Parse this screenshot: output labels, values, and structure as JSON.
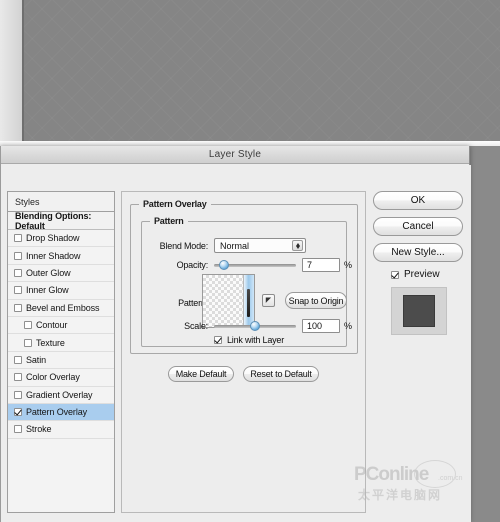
{
  "window": {
    "title": "Layer Style"
  },
  "styles_panel": {
    "header": "Styles",
    "blending_options": "Blending Options: Default",
    "items": [
      {
        "label": "Drop Shadow",
        "checked": false,
        "indent": false,
        "selected": false
      },
      {
        "label": "Inner Shadow",
        "checked": false,
        "indent": false,
        "selected": false
      },
      {
        "label": "Outer Glow",
        "checked": false,
        "indent": false,
        "selected": false
      },
      {
        "label": "Inner Glow",
        "checked": false,
        "indent": false,
        "selected": false
      },
      {
        "label": "Bevel and Emboss",
        "checked": false,
        "indent": false,
        "selected": false
      },
      {
        "label": "Contour",
        "checked": false,
        "indent": true,
        "selected": false
      },
      {
        "label": "Texture",
        "checked": false,
        "indent": true,
        "selected": false
      },
      {
        "label": "Satin",
        "checked": false,
        "indent": false,
        "selected": false
      },
      {
        "label": "Color Overlay",
        "checked": false,
        "indent": false,
        "selected": false
      },
      {
        "label": "Gradient Overlay",
        "checked": false,
        "indent": false,
        "selected": false
      },
      {
        "label": "Pattern Overlay",
        "checked": true,
        "indent": false,
        "selected": true
      },
      {
        "label": "Stroke",
        "checked": false,
        "indent": false,
        "selected": false
      }
    ]
  },
  "pattern_overlay": {
    "group_title": "Pattern Overlay",
    "inner_group_title": "Pattern",
    "blend_mode": {
      "label": "Blend Mode:",
      "value": "Normal"
    },
    "opacity": {
      "label": "Opacity:",
      "value": "7",
      "unit": "%",
      "percent": 7
    },
    "pattern": {
      "label": "Pattern:",
      "preset_button_glyph": "◤",
      "snap_button": "Snap to Origin"
    },
    "scale": {
      "label": "Scale:",
      "value": "100",
      "unit": "%",
      "percent": 50
    },
    "link_with_layer": {
      "label": "Link with Layer",
      "checked": true
    },
    "make_default": "Make Default",
    "reset_to_default": "Reset to Default"
  },
  "actions": {
    "ok": "OK",
    "cancel": "Cancel",
    "new_style": "New Style...",
    "preview": {
      "label": "Preview",
      "checked": true
    }
  },
  "watermark": {
    "brand": "PConline",
    "domain": ".com.cn",
    "chinese": "太平洋电脑网"
  },
  "colors": {
    "selection_blue": "#a9cdee",
    "dialog_bg": "#ededed",
    "desktop_gray": "#858585",
    "preview_swatch": "#4c4c4c"
  }
}
